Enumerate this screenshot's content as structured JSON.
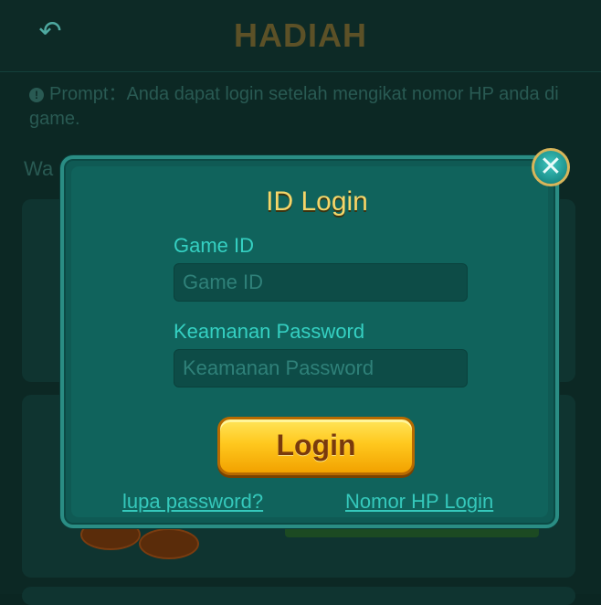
{
  "background": {
    "title": "HADIAH",
    "back_icon": "undo-arrow-icon",
    "prompt": "Prompt：Anda dapat login setelah mengikat nomor HP anda di game.",
    "section_label": "Wa"
  },
  "modal": {
    "title": "ID Login",
    "game_id": {
      "label": "Game ID",
      "placeholder": "Game ID",
      "value": ""
    },
    "password": {
      "label": "Keamanan Password",
      "placeholder": "Keamanan Password",
      "value": ""
    },
    "login_label": "Login",
    "forgot_link": "lupa password?",
    "phone_login_link": "Nomor HP Login",
    "close_icon": "close-icon"
  },
  "colors": {
    "accent_teal": "#35d0c2",
    "title_gold": "#f4d66a",
    "button_gold": "#ffc81e"
  }
}
